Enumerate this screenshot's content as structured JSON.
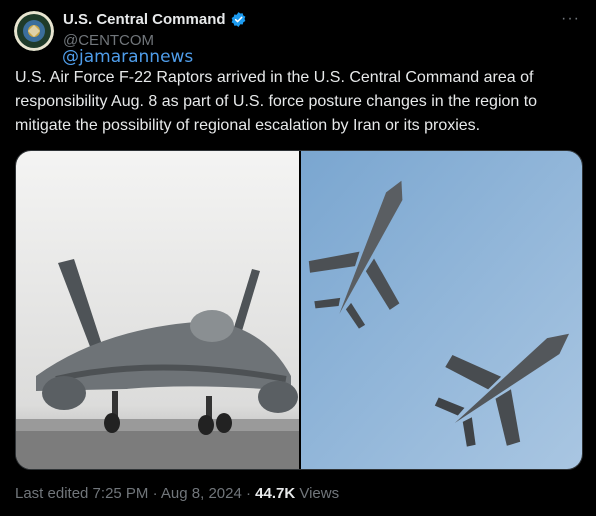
{
  "author": {
    "name": "U.S. Central Command",
    "handle": "@CENTCOM",
    "avatar_icon": "centcom-seal-icon",
    "verified_icon": "verified-badge-icon"
  },
  "watermark": "@jamarannews",
  "tweet": {
    "text": "U.S. Air Force F-22 Raptors arrived in the U.S. Central Command area of responsibility Aug. 8 as part of U.S. force posture changes in the region to mitigate the possibility of regional escalation by Iran or its proxies."
  },
  "media": [
    {
      "icon": "f22-ground-photo"
    },
    {
      "icon": "f22-flight-photo"
    }
  ],
  "footer": {
    "edited": "Last edited 7:25 PM · Aug 8, 2024 · ",
    "views_count": "44.7K",
    "views_label": " Views"
  },
  "more_icon": "more-options-icon",
  "colors": {
    "background": "#000000",
    "text": "#e7e9ea",
    "muted": "#71767b",
    "verified": "#1d9bf0",
    "link": "#4f9dea"
  }
}
